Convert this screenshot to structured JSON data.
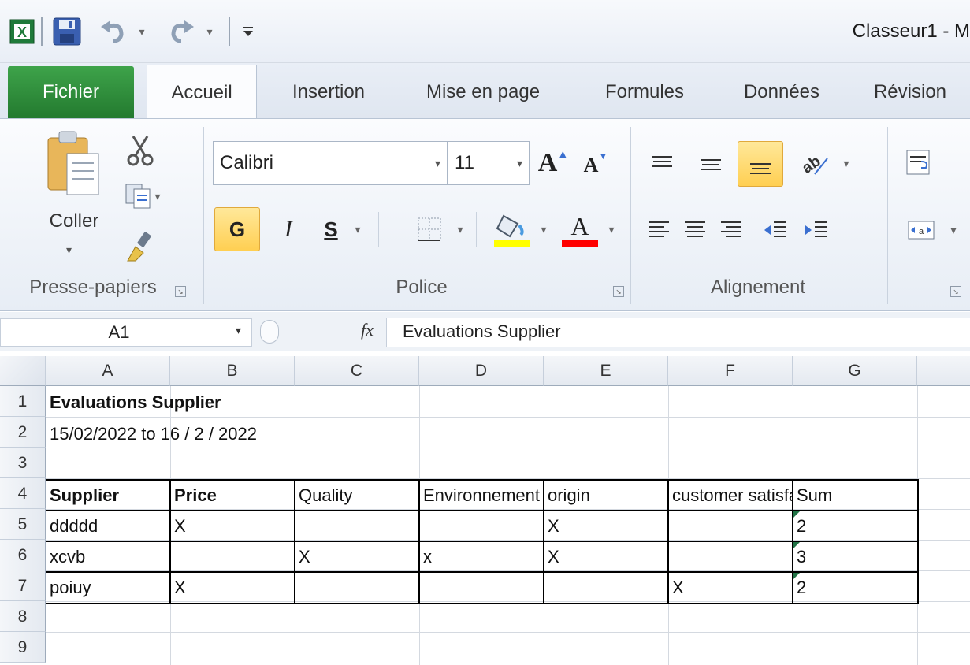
{
  "window": {
    "title": "Classeur1  -  M"
  },
  "quick_access": {
    "icons": [
      "excel-icon",
      "save-icon",
      "undo-icon",
      "redo-icon",
      "customize-icon"
    ]
  },
  "tabs": [
    {
      "label": "Fichier"
    },
    {
      "label": "Accueil"
    },
    {
      "label": "Insertion"
    },
    {
      "label": "Mise en page"
    },
    {
      "label": "Formules"
    },
    {
      "label": "Données"
    },
    {
      "label": "Révision"
    }
  ],
  "ribbon": {
    "clipboard": {
      "paste_label": "Coller",
      "group_label": "Presse-papiers"
    },
    "font": {
      "font_name": "Calibri",
      "font_size": "11",
      "bold_label": "G",
      "italic_label": "I",
      "underline_label": "S",
      "group_label": "Police",
      "fill_color": "#ffff00",
      "font_color": "#ff0000"
    },
    "alignment": {
      "group_label": "Alignement"
    }
  },
  "formula_bar": {
    "name_box": "A1",
    "fx_label": "fx",
    "formula": "Evaluations Supplier"
  },
  "grid": {
    "columns": [
      "A",
      "B",
      "C",
      "D",
      "E",
      "F",
      "G"
    ],
    "rows": [
      "1",
      "2",
      "3",
      "4",
      "5",
      "6",
      "7",
      "8",
      "9"
    ],
    "cells": {
      "A1": "Evaluations Supplier",
      "A2": "15/02/2022 to 16 / 2 / 2022",
      "A4": "Supplier",
      "B4": "Price",
      "C4": "Quality",
      "D4": "Environnement",
      "E4": "origin",
      "F4": "customer satisfaction",
      "G4": "Sum",
      "A5": "ddddd",
      "B5": "X",
      "E5": "X",
      "G5": "2",
      "A6": "xcvb",
      "C6": "X",
      "D6": "x",
      "E6": "X",
      "G6": "3",
      "A7": "poiuy",
      "B7": "X",
      "F7": "X",
      "G7": "2"
    }
  }
}
